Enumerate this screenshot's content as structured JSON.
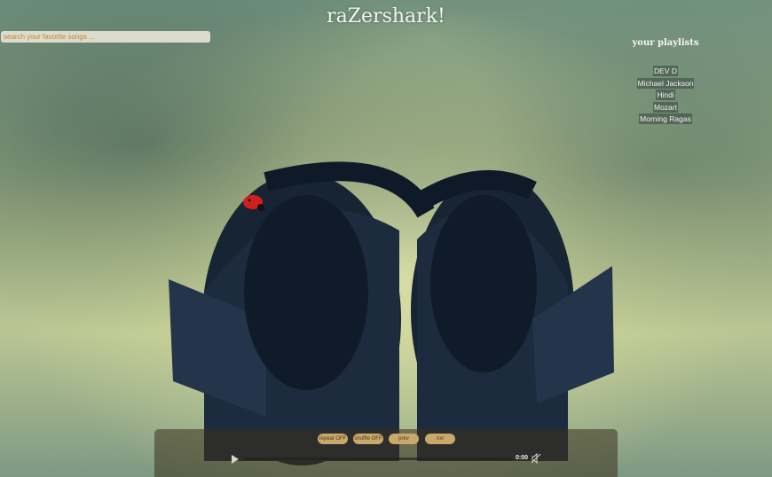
{
  "header": {
    "title": "raZershark!"
  },
  "search": {
    "placeholder": "search your favorite songs ..."
  },
  "playlists": {
    "heading": "your playlists",
    "items": [
      {
        "label": "DEV D"
      },
      {
        "label": "Michael Jackson"
      },
      {
        "label": "Hindi"
      },
      {
        "label": "Mozart"
      },
      {
        "label": "Morning Ragas"
      }
    ]
  },
  "player": {
    "repeat_label": "repeat OFF",
    "shuffle_label": "shuffle OFF",
    "prev_label": "prev",
    "next_label": "nxt",
    "time": "0:00",
    "progress": 0
  },
  "icons": {
    "play": "play-icon",
    "mute": "mute-icon"
  },
  "colors": {
    "button_bg": "#c9a86a",
    "controls_bg": "#3c321e",
    "title_text": "#f4f6ee"
  }
}
